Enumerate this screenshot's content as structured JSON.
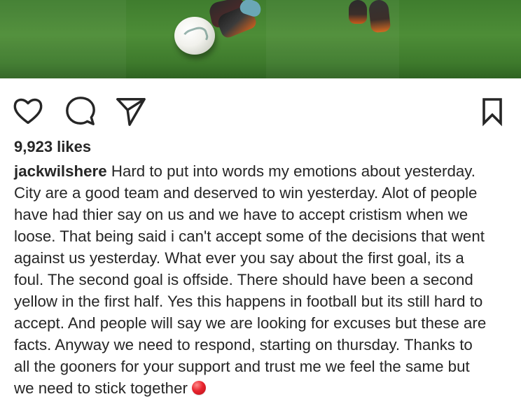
{
  "post": {
    "photo_subject": "",
    "actions": {
      "like_icon": "heart-outline-icon",
      "comment_icon": "comment-bubble-icon",
      "share_icon": "paper-plane-icon",
      "save_icon": "bookmark-outline-icon"
    },
    "likes_text": "9,923 likes",
    "caption": {
      "username": "jackwilshere",
      "lines": [
        "Hard to put into words my emotions about yesterday.",
        "City are a good team and deserved to win yesterday. Alot of people",
        "have had thier say on us and we have to accept cristism when we",
        "loose. That being said i can't accept some of the decisions that went",
        "against us yesterday. What ever you say about the first goal, its a",
        "foul. The second goal is offside. There should have been a second",
        "yellow in the first half. Yes this happens in football but its still hard to",
        "accept. And people will say we are looking for excuses but these are",
        "facts.  Anyway we need to respond, starting on thursday. Thanks to",
        "all the gooners for your support and trust me we feel the same but",
        "we need to stick together"
      ],
      "trailing_emoji": "red-circle-emoji"
    }
  },
  "colors": {
    "text": "#262626",
    "icon_stroke": "#262626",
    "emoji_red": "#e8242e",
    "grass": "#4d8d37"
  }
}
